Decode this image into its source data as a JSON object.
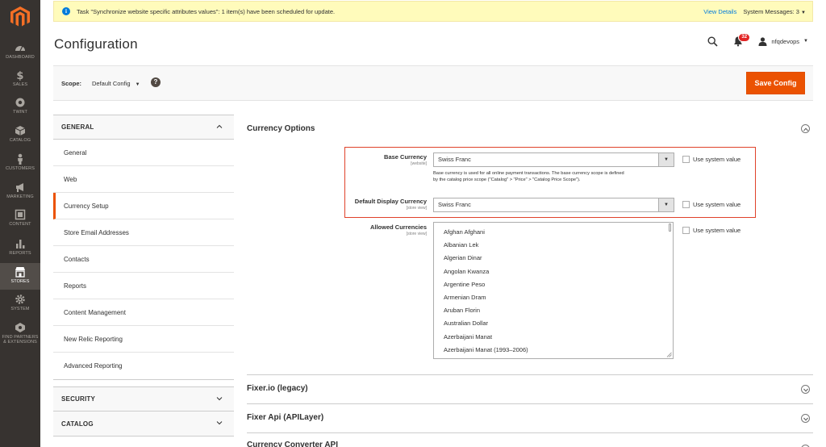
{
  "nav": {
    "items": [
      {
        "label": "DASHBOARD"
      },
      {
        "label": "SALES"
      },
      {
        "label": "TWINT"
      },
      {
        "label": "CATALOG"
      },
      {
        "label": "CUSTOMERS"
      },
      {
        "label": "MARKETING"
      },
      {
        "label": "CONTENT"
      },
      {
        "label": "REPORTS"
      },
      {
        "label": "STORES"
      },
      {
        "label": "SYSTEM"
      },
      {
        "label_line1": "FIND PARTNERS",
        "label_line2": "& EXTENSIONS"
      }
    ],
    "active": "STORES"
  },
  "notice": {
    "message": "Task \"Synchronize website specific attributes values\": 1 item(s) have been scheduled for update.",
    "view_details": "View Details",
    "system_messages": "System Messages: 3"
  },
  "header": {
    "title": "Configuration",
    "notification_count": "32",
    "username": "nfqdevops"
  },
  "scope": {
    "label": "Scope:",
    "value": "Default Config",
    "help": "?",
    "save_button": "Save Config"
  },
  "tabs": {
    "groups": [
      {
        "label": "GENERAL",
        "expanded": true
      },
      {
        "label": "SECURITY",
        "expanded": false
      },
      {
        "label": "CATALOG",
        "expanded": false
      }
    ],
    "general_items": [
      "General",
      "Web",
      "Currency Setup",
      "Store Email Addresses",
      "Contacts",
      "Reports",
      "Content Management",
      "New Relic Reporting",
      "Advanced Reporting"
    ],
    "active_item": "Currency Setup"
  },
  "section": {
    "title": "Currency Options",
    "base_currency": {
      "label": "Base Currency",
      "scope": "[website]",
      "value": "Swiss Franc",
      "use_system": "Use system value",
      "note_line1": "Base currency is used for all online payment transactions. The base currency scope is defined",
      "note_line2": "by the catalog price scope (\"Catalog\" > \"Price\" > \"Catalog Price Scope\")."
    },
    "display_currency": {
      "label": "Default Display Currency",
      "scope": "[store view]",
      "value": "Swiss Franc",
      "use_system": "Use system value"
    },
    "allowed_currencies": {
      "label": "Allowed Currencies",
      "scope": "[store view]",
      "use_system": "Use system value",
      "options": [
        "Afghan Afghani",
        "Albanian Lek",
        "Algerian Dinar",
        "Angolan Kwanza",
        "Argentine Peso",
        "Armenian Dram",
        "Aruban Florin",
        "Australian Dollar",
        "Azerbaijani Manat",
        "Azerbaijani Manat (1993–2006)"
      ]
    }
  },
  "collapsed_sections": [
    "Fixer.io (legacy)",
    "Fixer Api (APILayer)",
    "Currency Converter API"
  ],
  "colors": {
    "accent": "#eb5202",
    "nav_bg": "#373330",
    "notice_bg": "#fffbbb",
    "highlight": "#e0422a",
    "link": "#007bdb"
  }
}
